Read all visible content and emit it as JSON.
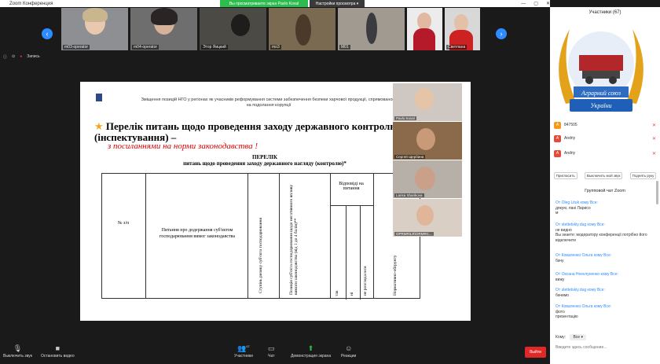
{
  "titlebar": {
    "app": "Zoom Конференция",
    "share_banner": "Вы просматриваете экран Pavlo Koval",
    "view_options": "Настройки просмотра ▾",
    "controls": [
      "—",
      "▢",
      "✕"
    ]
  },
  "strip": {
    "thumbs": [
      {
        "label": "m03-operator"
      },
      {
        "label": "m04-operator"
      },
      {
        "label": "Этор Яицкий"
      },
      {
        "label": "mo3"
      },
      {
        "label": "M01"
      },
      {
        "label": "Светлана"
      }
    ]
  },
  "info": {
    "recording": "Запись"
  },
  "slide": {
    "header": "Зміщення позицій НГО у регіонах як учасників реформування системи забезпечення безпеки харчової продукції, спрямованого на подолання корупції",
    "list_title": "Перелік питань щодо проведення заходу державного контролю (інспектування) –",
    "list_sub": "з посиланнями на норми законодавства !",
    "perelik_title": "ПЕРЕЛІК",
    "perelik_sub": "питань щодо проведення заходу державного нагляду (контролю)*",
    "col_no": "№ з/п",
    "col_question": "Питання про додержання суб'єктом господарювання вимог законодавства",
    "col_risk": "Ступінь ризику суб'єкта господарювання",
    "col_risk2": "Позиція суб'єкта господарювання щодо негативного впливу вимоги законодавства (від 1 до 4 балів)**",
    "col_answers": "Відповіді на питання",
    "ans_yes": "так",
    "ans_no": "ні",
    "ans_na": "не розглядалося",
    "col_norm": "Нормативно-обґрунту"
  },
  "speakers": [
    {
      "name": "Pavlo Koval"
    },
    {
      "name": "Сергей Щербина"
    },
    {
      "name": "Larisa Sharikova"
    },
    {
      "name": "OPRMR\\LR\\ORMRC..."
    }
  ],
  "toolbar": {
    "mute": "Выключить звук",
    "video": "Остановить видео",
    "participants": "Участники",
    "participants_count": "67",
    "chat": "Чат",
    "share": "Демонстрация экрана",
    "reactions": "Реакции",
    "end": "Выйти"
  },
  "panel": {
    "title": "Участники (67)",
    "logo_text1": "Аграрний союз",
    "logo_text2": "України",
    "participants": [
      {
        "initial": "А",
        "name": "847505",
        "color": "orange"
      },
      {
        "initial": "А",
        "name": "Andriy",
        "color": "red"
      },
      {
        "initial": "А",
        "name": "Andriy",
        "color": "red"
      }
    ],
    "buttons": [
      "Пригласить",
      "Выключить мой звук",
      "Поднять руку"
    ],
    "chat_title": "Групповой чат Zoom",
    "messages": [
      {
        "from": "От Oleg Lituk кому Все:",
        "text": "дякую, пані Ларисо\nм"
      },
      {
        "from": "От stettetskiy.dug кому Все:",
        "text": "не видно\nВы знаете: модератору конференції потрібно його відключити"
      },
      {
        "from": "От Коваленко Ольга кому Все:",
        "text": "бачу"
      },
      {
        "from": "От Оксана Нееклуненко кому Все:",
        "text": "вижу"
      },
      {
        "from": "От stettetskiy.dug кому Все:",
        "text": "бачимо"
      },
      {
        "from": "От Коваленко Ольга кому Все:",
        "text": "фото\nпрезентацію"
      }
    ],
    "send_to_label": "Кому:",
    "send_to_value": "Все ▾",
    "input_placeholder": "Введите здесь сообщение..."
  },
  "colors": {
    "accent": "#2d8cff",
    "share_green": "#2dbd4e",
    "end_red": "#e02828"
  }
}
